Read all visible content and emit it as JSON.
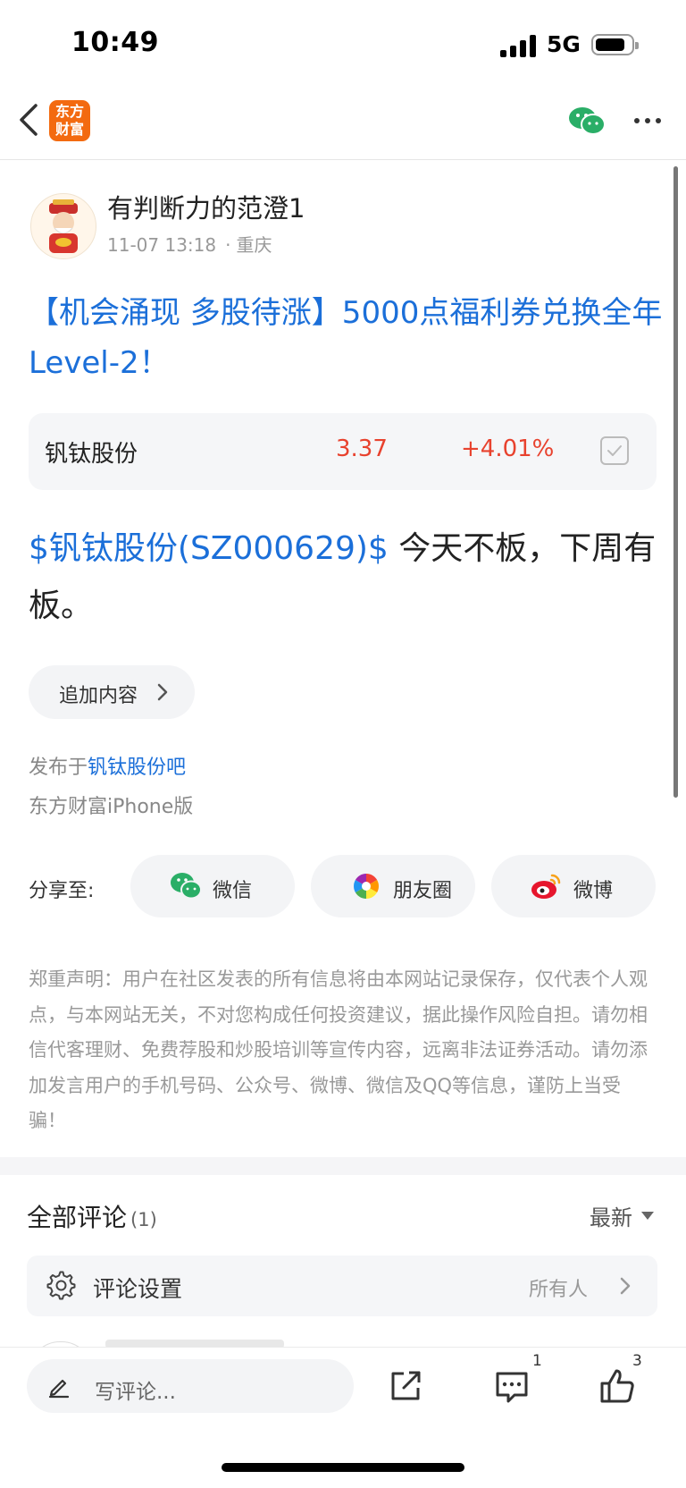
{
  "status_bar": {
    "time": "10:49",
    "network": "5G"
  },
  "nav": {
    "logo_line1": "东方",
    "logo_line2": "财富"
  },
  "post": {
    "author": "有判断力的范澄1",
    "date": "11-07 13:18",
    "meta_sep": "·",
    "location": "重庆",
    "title": "【机会涌现 多股待涨】5000点福利券兑换全年Level-2！",
    "stock": {
      "name": "钒钛股份",
      "price": "3.37",
      "change": "+4.01%"
    },
    "body_tag": "$钒钛股份(SZ000629)$",
    "body_text": " 今天不板，下周有板。",
    "append_label": "追加内容",
    "published_prefix": "发布于",
    "published_bar": "钒钛股份吧",
    "client": "东方财富iPhone版"
  },
  "share": {
    "label": "分享至:",
    "wechat": "微信",
    "moments": "朋友圈",
    "weibo": "微博"
  },
  "disclaimer": "郑重声明：用户在社区发表的所有信息将由本网站记录保存，仅代表个人观点，与本网站无关，不对您构成任何投资建议，据此操作风险自担。请勿相信代客理财、免费荐股和炒股培训等宣传内容，远离非法证券活动。请勿添加发言用户的手机号码、公众号、微博、微信及QQ等信息，谨防上当受骗！",
  "comments": {
    "title": "全部评论",
    "count": "(1)",
    "sort": "最新",
    "settings_label": "评论设置",
    "settings_value": "所有人"
  },
  "bottom_bar": {
    "placeholder": "写评论...",
    "comment_count": "1",
    "like_count": "3"
  },
  "colors": {
    "link_blue": "#1b6fd9",
    "stock_red": "#e8422e",
    "brand_orange": "#f36a10",
    "wechat_green": "#2aae67"
  }
}
